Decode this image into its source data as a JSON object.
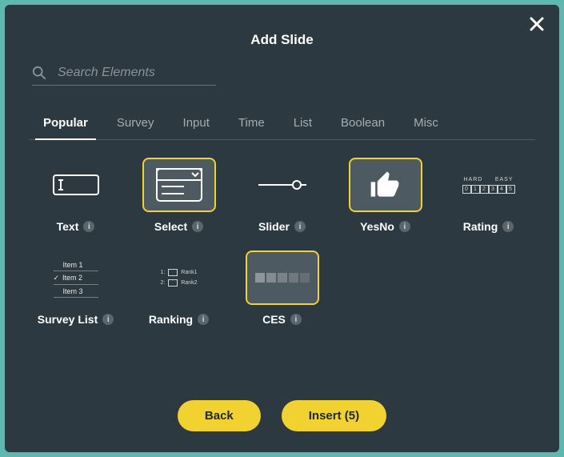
{
  "title": "Add Slide",
  "search": {
    "placeholder": "Search Elements"
  },
  "tabs": [
    {
      "label": "Popular",
      "active": true
    },
    {
      "label": "Survey"
    },
    {
      "label": "Input"
    },
    {
      "label": "Time"
    },
    {
      "label": "List"
    },
    {
      "label": "Boolean"
    },
    {
      "label": "Misc"
    }
  ],
  "tiles": [
    {
      "label": "Text",
      "selected": false
    },
    {
      "label": "Select",
      "selected": true
    },
    {
      "label": "Slider",
      "selected": false
    },
    {
      "label": "YesNo",
      "selected": true
    },
    {
      "label": "Rating",
      "selected": false
    },
    {
      "label": "Survey List",
      "selected": false
    },
    {
      "label": "Ranking",
      "selected": false
    },
    {
      "label": "CES",
      "selected": true
    }
  ],
  "rating_preview": {
    "left_label": "HARD",
    "right_label": "EASY",
    "cells": [
      "0",
      "1",
      "2",
      "3",
      "4",
      "5"
    ]
  },
  "survey_list_preview": [
    "Item 1",
    "Item 2",
    "Item 3"
  ],
  "ranking_preview": [
    {
      "num": "1:",
      "name": "Rank1"
    },
    {
      "num": "2:",
      "name": "Rank2"
    }
  ],
  "footer": {
    "back": "Back",
    "insert": "Insert (5)"
  }
}
